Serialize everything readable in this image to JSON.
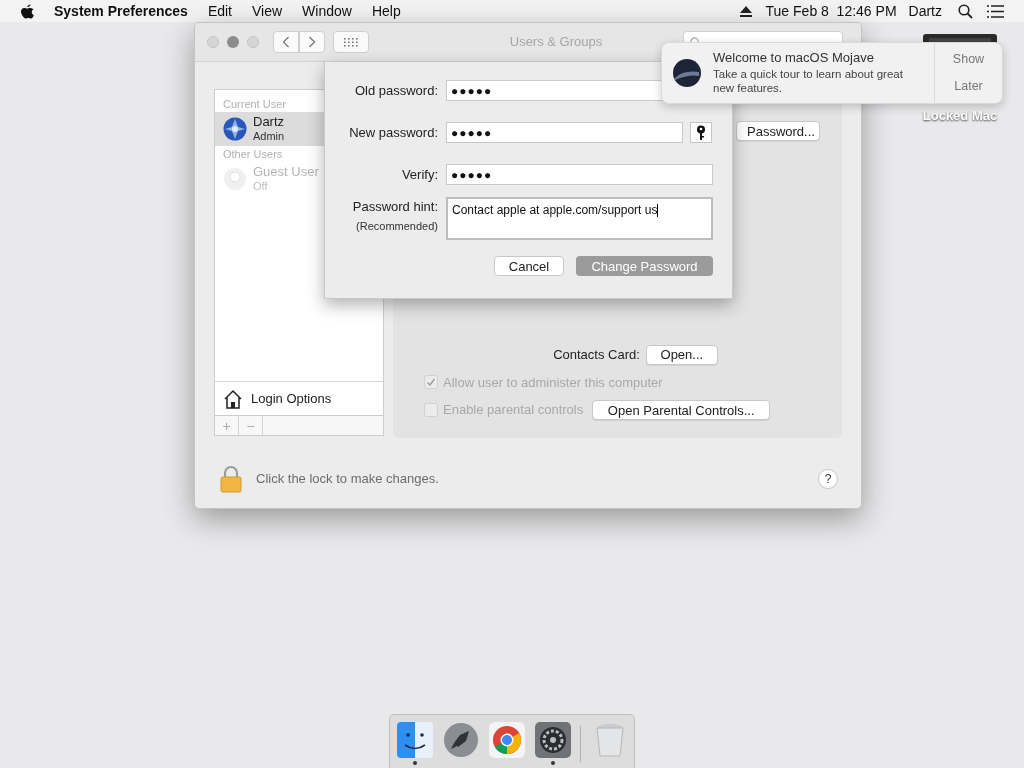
{
  "menu_bar": {
    "app": "System Preferences",
    "menus": [
      "Edit",
      "View",
      "Window",
      "Help"
    ],
    "clock": "Tue Feb 8  12:46 PM",
    "user": "Dartz"
  },
  "desktop_icon": {
    "label": "Locked Mac"
  },
  "window": {
    "title": "Users & Groups",
    "sidebar": {
      "sections": [
        {
          "heading": "Current User",
          "users": [
            {
              "name": "Dartz",
              "role": "Admin",
              "selected": true,
              "disabled": false
            }
          ]
        },
        {
          "heading": "Other Users",
          "users": [
            {
              "name": "Guest User",
              "role": "Off",
              "selected": false,
              "disabled": true
            }
          ]
        }
      ],
      "login_options": "Login Options",
      "add": "+",
      "remove": "−"
    },
    "panel": {
      "password_button": "Password...",
      "contacts_label": "Contacts Card:",
      "contacts_button": "Open...",
      "checkboxes": [
        {
          "label": "Allow user to administer this computer",
          "checked": true,
          "disabled": true
        },
        {
          "label": "Enable parental controls",
          "checked": false,
          "disabled": true
        }
      ],
      "parental_button": "Open Parental Controls..."
    },
    "lock_text": "Click the lock to make changes.",
    "help": "?"
  },
  "sheet": {
    "fields": [
      {
        "label": "Old password:",
        "value": "●●●●●",
        "kind": "plain"
      },
      {
        "label": "New password:",
        "value": "●●●●●",
        "kind": "assistant"
      },
      {
        "label": "Verify:",
        "value": "●●●●●",
        "kind": "plain"
      }
    ],
    "hint": {
      "label": "Password hint:",
      "sublabel": "(Recommended)",
      "value": "Contact apple at apple.com/support us"
    },
    "buttons": [
      {
        "label": "Cancel",
        "kind": "normal"
      },
      {
        "label": "Change Password",
        "kind": "default"
      }
    ]
  },
  "notification": {
    "title": "Welcome to macOS Mojave",
    "body": "Take a quick tour to learn about great new features.",
    "actions": [
      "Show",
      "Later"
    ]
  },
  "dock": [
    {
      "kind": "finder",
      "running": true
    },
    {
      "kind": "launchpad",
      "running": false
    },
    {
      "kind": "chrome",
      "running": false
    },
    {
      "kind": "settings",
      "running": true
    },
    {
      "kind": "trash",
      "running": false
    }
  ]
}
